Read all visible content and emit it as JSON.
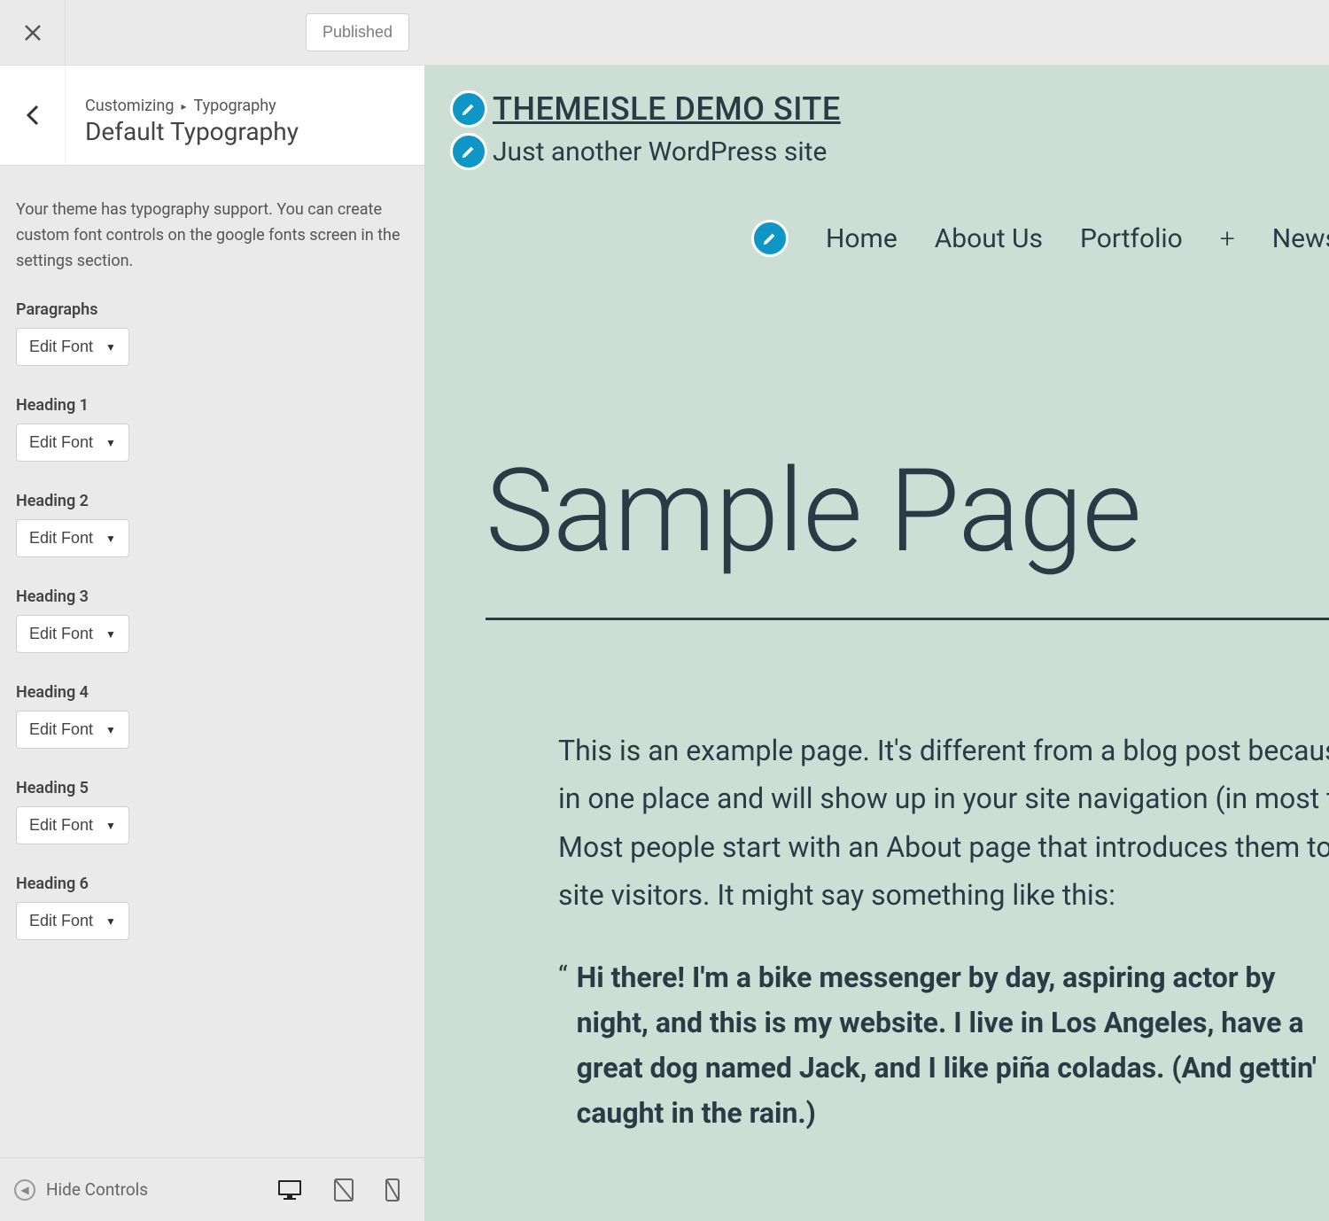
{
  "header": {
    "published_label": "Published"
  },
  "breadcrumb": {
    "root": "Customizing",
    "path": "Typography",
    "title": "Default Typography"
  },
  "description": "Your theme has typography support. You can create custom font controls on the google fonts screen in the settings section.",
  "controls": [
    {
      "label": "Paragraphs",
      "button": "Edit Font"
    },
    {
      "label": "Heading 1",
      "button": "Edit Font"
    },
    {
      "label": "Heading 2",
      "button": "Edit Font"
    },
    {
      "label": "Heading 3",
      "button": "Edit Font"
    },
    {
      "label": "Heading 4",
      "button": "Edit Font"
    },
    {
      "label": "Heading 5",
      "button": "Edit Font"
    },
    {
      "label": "Heading 6",
      "button": "Edit Font"
    }
  ],
  "footer": {
    "hide_controls": "Hide Controls"
  },
  "preview": {
    "site_title": "THEMEISLE DEMO SITE",
    "site_tagline": "Just another WordPress site",
    "nav": [
      "Home",
      "About Us",
      "Portfolio",
      "News"
    ],
    "page_title": "Sample Page",
    "paragraph": "This is an example page. It's different from a blog post because it will stay in one place and will show up in your site navigation (in most themes). Most people start with an About page that introduces them to potential site visitors. It might say something like this:",
    "quote": "Hi there! I'm a bike messenger by day, aspiring actor by night, and this is my website. I live in Los Angeles, have a great dog named Jack, and I like piña coladas. (And gettin' caught in the rain.)"
  }
}
